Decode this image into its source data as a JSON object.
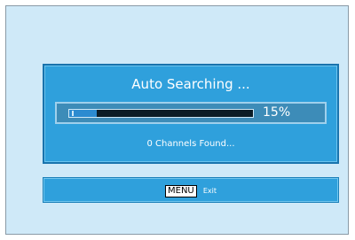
{
  "dialog": {
    "title": "Auto Searching ...",
    "progress": {
      "percent": 15,
      "label": "15%"
    },
    "status": "0 Channels Found..."
  },
  "footer": {
    "key_label": "MENU",
    "action_label": "Exit"
  },
  "colors": {
    "screen_background": "#cfe9f8",
    "dialog_background": "#2fa0dc",
    "progress_fill": "#2c8bd0",
    "text": "#ffffff"
  }
}
